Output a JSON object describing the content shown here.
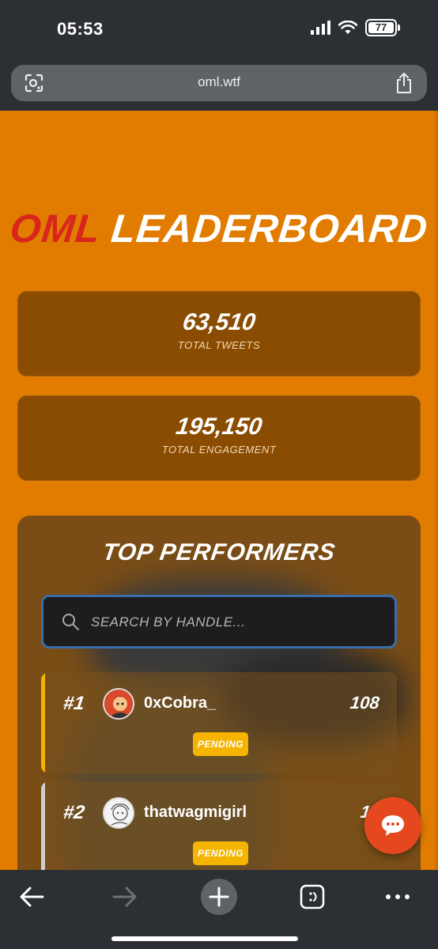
{
  "status_bar": {
    "time": "05:53",
    "battery": "77"
  },
  "browser": {
    "url": "oml.wtf"
  },
  "page": {
    "title_accent": "OML",
    "title_rest": "LEADERBOARD",
    "stats": [
      {
        "value": "63,510",
        "label": "TOTAL TWEETS"
      },
      {
        "value": "195,150",
        "label": "TOTAL ENGAGEMENT"
      }
    ],
    "performers": {
      "title": "TOP PERFORMERS",
      "search_placeholder": "SEARCH BY HANDLE...",
      "rows": [
        {
          "rank": "#1",
          "handle": "0xCobra_",
          "score": "108",
          "status": "PENDING",
          "accent": "#f4b400"
        },
        {
          "rank": "#2",
          "handle": "thatwagmigirl",
          "score": "10",
          "status": "PENDING",
          "accent": "#cfcfcf"
        }
      ]
    }
  },
  "colors": {
    "page_bg": "#e27c00",
    "title_red": "#d9261c",
    "badge": "#f4b400",
    "search_border": "#3b6ea8",
    "chat_button": "#e5481e"
  }
}
